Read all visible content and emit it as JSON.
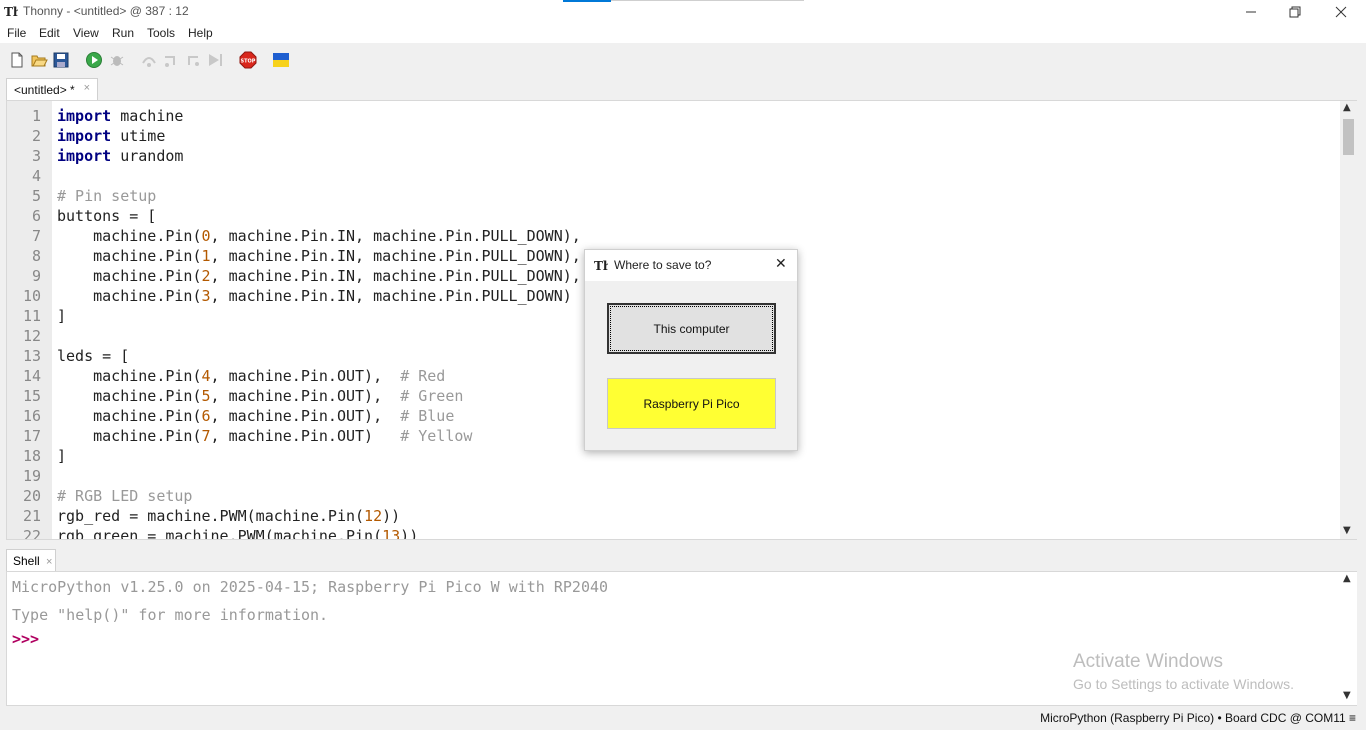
{
  "window": {
    "title": "Thonny  -  <untitled>  @  387 : 12"
  },
  "menu": [
    "File",
    "Edit",
    "View",
    "Run",
    "Tools",
    "Help"
  ],
  "toolbar_icons": [
    "new-file-icon",
    "open-folder-icon",
    "save-icon",
    "run-icon",
    "debug-icon",
    "step-over-icon",
    "step-into-icon",
    "step-out-icon",
    "resume-icon",
    "stop-icon",
    "ukraine-flag-icon"
  ],
  "editor": {
    "tab_label": "<untitled> *",
    "lines": [
      {
        "n": "1",
        "kw": "import",
        "rest": " machine"
      },
      {
        "n": "2",
        "kw": "import",
        "rest": " utime"
      },
      {
        "n": "3",
        "kw": "import",
        "rest": " urandom"
      },
      {
        "n": "4",
        "kw": "",
        "rest": ""
      },
      {
        "n": "5",
        "kw": "",
        "rest": "",
        "comment": "# Pin setup"
      },
      {
        "n": "6",
        "kw": "",
        "rest": "buttons = ["
      },
      {
        "n": "7",
        "kw": "",
        "rest": "    machine.Pin(0, machine.Pin.IN, machine.Pin.PULL_DOWN),"
      },
      {
        "n": "8",
        "kw": "",
        "rest": "    machine.Pin(1, machine.Pin.IN, machine.Pin.PULL_DOWN),"
      },
      {
        "n": "9",
        "kw": "",
        "rest": "    machine.Pin(2, machine.Pin.IN, machine.Pin.PULL_DOWN),"
      },
      {
        "n": "10",
        "kw": "",
        "rest": "    machine.Pin(3, machine.Pin.IN, machine.Pin.PULL_DOWN)"
      },
      {
        "n": "11",
        "kw": "",
        "rest": "]"
      },
      {
        "n": "12",
        "kw": "",
        "rest": ""
      },
      {
        "n": "13",
        "kw": "",
        "rest": "leds = ["
      },
      {
        "n": "14",
        "kw": "",
        "rest": "    machine.Pin(4, machine.Pin.OUT),  ",
        "comment": "# Red"
      },
      {
        "n": "15",
        "kw": "",
        "rest": "    machine.Pin(5, machine.Pin.OUT),  ",
        "comment": "# Green"
      },
      {
        "n": "16",
        "kw": "",
        "rest": "    machine.Pin(6, machine.Pin.OUT),  ",
        "comment": "# Blue"
      },
      {
        "n": "17",
        "kw": "",
        "rest": "    machine.Pin(7, machine.Pin.OUT)   ",
        "comment": "# Yellow"
      },
      {
        "n": "18",
        "kw": "",
        "rest": "]"
      },
      {
        "n": "19",
        "kw": "",
        "rest": ""
      },
      {
        "n": "20",
        "kw": "",
        "rest": "",
        "comment": "# RGB LED setup"
      },
      {
        "n": "21",
        "kw": "",
        "rest": "rgb_red = machine.PWM(machine.Pin(12))"
      },
      {
        "n": "22",
        "kw": "",
        "rest": "rgb_green = machine.PWM(machine.Pin(13))"
      }
    ]
  },
  "shell": {
    "tab_label": "Shell",
    "line1": "MicroPython v1.25.0 on 2025-04-15; Raspberry Pi Pico W with RP2040",
    "line2": "Type \"help()\" for more information.",
    "prompt": ">>>"
  },
  "watermark": {
    "line1": "Activate Windows",
    "line2": "Go to Settings to activate Windows."
  },
  "status": {
    "text": "MicroPython (Raspberry Pi Pico)  •  Board CDC @ COM11  ≡"
  },
  "dialog": {
    "title": "Where to save to?",
    "btn_computer": "This computer",
    "btn_pico": "Raspberry Pi Pico",
    "highlight_color": "#ffff33"
  }
}
